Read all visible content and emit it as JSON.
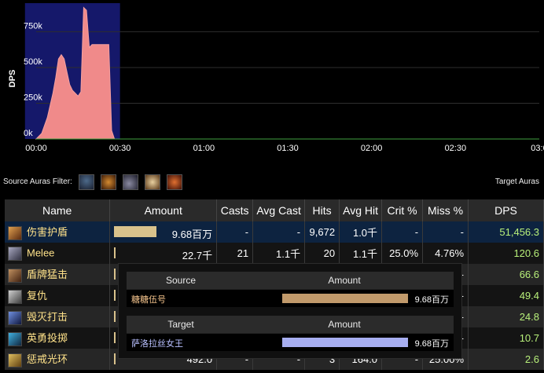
{
  "chart_data": {
    "type": "area",
    "ylabel": "DPS",
    "yticks": [
      "0k",
      "250k",
      "500k",
      "750k"
    ],
    "xticks": [
      "00:00",
      "00:30",
      "01:00",
      "01:30",
      "02:00",
      "02:30",
      "03:0"
    ],
    "ylim": [
      0,
      950000
    ],
    "xlim": [
      0,
      180
    ],
    "highlight_range_seconds": [
      -4,
      30
    ],
    "series": [
      {
        "color": "#f08a8a",
        "x": [
          0,
          2,
          4,
          6,
          7,
          8,
          9,
          10,
          11,
          12,
          13,
          14,
          15,
          16,
          17,
          18,
          19,
          20,
          21,
          22,
          23,
          24,
          25,
          26,
          27,
          28
        ],
        "y": [
          0,
          40000,
          150000,
          320000,
          430000,
          560000,
          590000,
          560000,
          470000,
          380000,
          340000,
          320000,
          300000,
          330000,
          920000,
          900000,
          640000,
          660000,
          660000,
          660000,
          660000,
          660000,
          660000,
          660000,
          60000,
          0
        ]
      }
    ]
  },
  "aura_filter": {
    "label": "Source Auras Filter:",
    "right_label": "Target Auras",
    "icons": [
      "shield-buff-icon",
      "fire-buff-icon",
      "shadow-buff-icon",
      "holy-buff-icon",
      "strike-buff-icon"
    ]
  },
  "table": {
    "headers": [
      "Name",
      "Amount",
      "Casts",
      "Avg Cast",
      "Hits",
      "Avg Hit",
      "Crit %",
      "Miss %",
      "DPS"
    ],
    "rows": [
      {
        "name": "伤害护盾",
        "icon": "damage-shield-icon",
        "amount": "9.68百万",
        "amount_fraction": 0.43,
        "casts": "-",
        "avg_cast": "-",
        "hits": "9,672",
        "avg_hit": "1.0千",
        "crit": "-",
        "miss": "-",
        "dps": "51,456.3"
      },
      {
        "name": "Melee",
        "icon": "melee-icon",
        "amount": "22.7千",
        "amount_fraction": 0.002,
        "casts": "21",
        "avg_cast": "1.1千",
        "hits": "20",
        "avg_hit": "1.1千",
        "crit": "25.0%",
        "miss": "4.76%",
        "dps": "120.6"
      },
      {
        "name": "盾牌猛击",
        "icon": "shield-slam-icon",
        "amount": "",
        "amount_fraction": 0.0015,
        "casts": "",
        "avg_cast": "",
        "hits": "",
        "avg_hit": "",
        "crit": "",
        "miss": "-",
        "dps": "66.6"
      },
      {
        "name": "复仇",
        "icon": "revenge-icon",
        "amount": "",
        "amount_fraction": 0.001,
        "casts": "",
        "avg_cast": "",
        "hits": "",
        "avg_hit": "",
        "crit": "",
        "miss": "-",
        "dps": "49.4"
      },
      {
        "name": "毁灭打击",
        "icon": "devastate-icon",
        "amount": "",
        "amount_fraction": 0.0008,
        "casts": "",
        "avg_cast": "",
        "hits": "",
        "avg_hit": "",
        "crit": "",
        "miss": "-",
        "dps": "24.8"
      },
      {
        "name": "英勇投掷",
        "icon": "heroic-throw-icon",
        "amount": "",
        "amount_fraction": 0.0005,
        "casts": "",
        "avg_cast": "",
        "hits": "",
        "avg_hit": "",
        "crit": "",
        "miss": "-",
        "dps": "10.7"
      },
      {
        "name": "惩戒光环",
        "icon": "retribution-aura-icon",
        "amount": "492.0",
        "amount_fraction": 0.0002,
        "casts": "-",
        "avg_cast": "-",
        "hits": "3",
        "avg_hit": "164.0",
        "crit": "-",
        "miss": "25.00%",
        "dps": "2.6"
      }
    ]
  },
  "tooltip": {
    "source_header": "Source",
    "amount_header": "Amount",
    "source_name": "糖糖伍号",
    "source_amount": "9.68百万",
    "source_color": "#c19a6b",
    "target_header": "Target",
    "target_name": "萨洛拉丝女王",
    "target_amount": "9.68百万",
    "target_color": "#a7aef0"
  }
}
